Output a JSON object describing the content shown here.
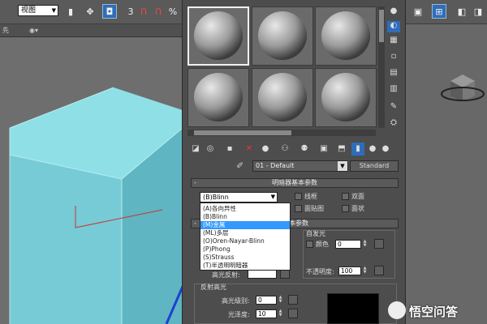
{
  "toolbar": {
    "view_select": "视图",
    "angle_snap_label": "3",
    "percent_snap_label": "%"
  },
  "subbar": {
    "left_label": "先"
  },
  "material_editor": {
    "material_name": "01 - Default",
    "type_button": "Standard",
    "shader_rollout_title": "明暗器基本参数",
    "shader_selected": "(B)Blinn",
    "shader_options": [
      "(A)各向异性",
      "(B)Blinn",
      "(M)金属",
      "(ML)多层",
      "(O)Oren-Nayar-Blinn",
      "(P)Phong",
      "(S)Strauss",
      "(T)半透明明暗器"
    ],
    "shader_selected_index": 2,
    "checkboxes": {
      "wire": "线框",
      "two_sided": "双面",
      "face_map": "面贴图",
      "faceted": "面状"
    },
    "basic_params_title_suffix": "n 基本参数",
    "self_illum": {
      "label": "自发光",
      "color_label": "颜色",
      "value": "0"
    },
    "opacity": {
      "label": "不透明度:",
      "value": "100"
    },
    "specular_label": "高光反射:",
    "highlights": {
      "label": "反射高光",
      "level_label": "高光级别:",
      "level_value": "0",
      "gloss_label": "光泽度:",
      "gloss_value": "10"
    }
  },
  "watermark": {
    "text": "悟空问答"
  },
  "colors": {
    "cube_top": "#8fdfe6",
    "cube_front": "#76cbd6",
    "cube_side": "#5fb5c1",
    "selection_blue": "#3399ff",
    "active_button": "#2f6dbb"
  },
  "icons": [
    "select-icon",
    "move-icon",
    "snap-icon",
    "magnet-icon",
    "delete-icon",
    "sphere-icon",
    "checker-icon",
    "viewcube-icon",
    "eyedropper-icon"
  ]
}
